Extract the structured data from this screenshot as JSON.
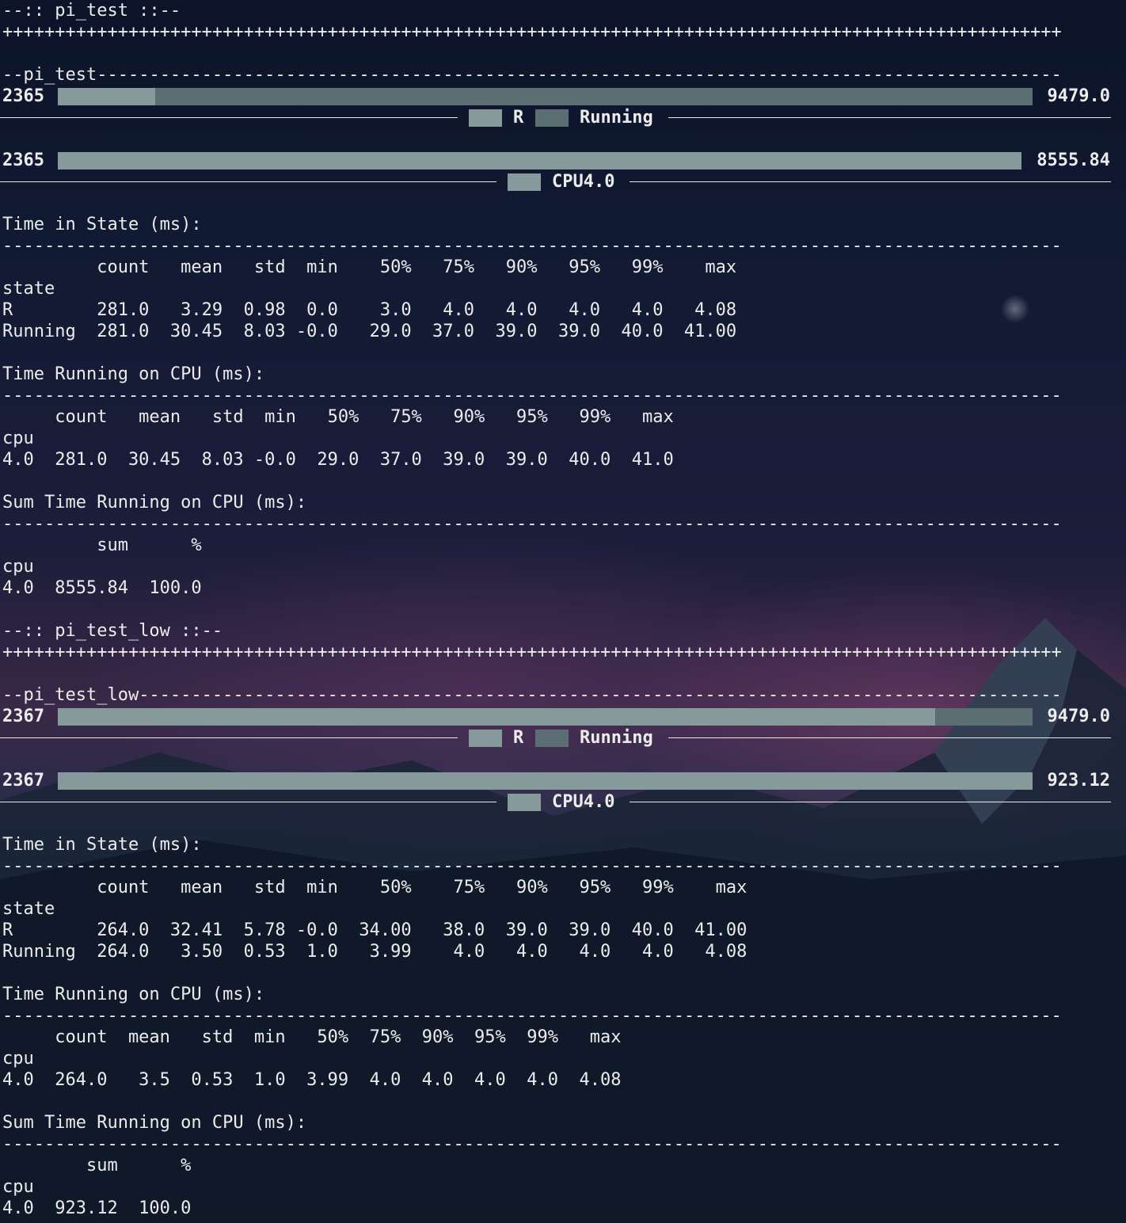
{
  "colors": {
    "light_segment": "#86999b",
    "dark_segment": "#5a6e73"
  },
  "sections": [
    {
      "header": "--:: pi_test ::--",
      "task_label": "--pi_test",
      "state_bar": {
        "pid": "2365",
        "max": "9479.0",
        "segments": [
          {
            "state": "R",
            "fraction": 0.1,
            "color": "light"
          },
          {
            "state": "Running",
            "fraction": 0.9,
            "color": "dark"
          }
        ],
        "legend": [
          {
            "label": "R",
            "color": "light"
          },
          {
            "label": "Running",
            "color": "dark"
          }
        ]
      },
      "cpu_bar": {
        "pid": "2365",
        "max": "8555.84",
        "segments": [
          {
            "state": "CPU4.0",
            "fraction": 1.0,
            "color": "light"
          }
        ],
        "legend": [
          {
            "label": "CPU4.0",
            "color": "light"
          }
        ]
      },
      "time_in_state": {
        "title": "Time in State (ms):",
        "lines": [
          "         count   mean   std  min    50%   75%   90%   95%   99%    max",
          "state",
          "R        281.0   3.29  0.98  0.0    3.0   4.0   4.0   4.0   4.0   4.08",
          "Running  281.0  30.45  8.03 -0.0   29.0  37.0  39.0  39.0  40.0  41.00"
        ]
      },
      "time_running": {
        "title": "Time Running on CPU (ms):",
        "lines": [
          "     count   mean   std  min   50%   75%   90%   95%   99%   max",
          "cpu",
          "4.0  281.0  30.45  8.03 -0.0  29.0  37.0  39.0  39.0  40.0  41.0"
        ]
      },
      "sum_time": {
        "title": "Sum Time Running on CPU (ms):",
        "lines": [
          "         sum      %",
          "cpu",
          "4.0  8555.84  100.0"
        ]
      }
    },
    {
      "header": "--:: pi_test_low ::--",
      "task_label": "--pi_test_low",
      "state_bar": {
        "pid": "2367",
        "max": "9479.0",
        "segments": [
          {
            "state": "R",
            "fraction": 0.9,
            "color": "light"
          },
          {
            "state": "Running",
            "fraction": 0.1,
            "color": "dark"
          }
        ],
        "legend": [
          {
            "label": "R",
            "color": "light"
          },
          {
            "label": "Running",
            "color": "dark"
          }
        ]
      },
      "cpu_bar": {
        "pid": "2367",
        "max": "923.12",
        "segments": [
          {
            "state": "CPU4.0",
            "fraction": 1.0,
            "color": "light"
          }
        ],
        "legend": [
          {
            "label": "CPU4.0",
            "color": "light"
          }
        ]
      },
      "time_in_state": {
        "title": "Time in State (ms):",
        "lines": [
          "         count   mean   std  min    50%    75%   90%   95%   99%    max",
          "state",
          "R        264.0  32.41  5.78 -0.0  34.00   38.0  39.0  39.0  40.0  41.00",
          "Running  264.0   3.50  0.53  1.0   3.99    4.0   4.0   4.0   4.0   4.08"
        ]
      },
      "time_running": {
        "title": "Time Running on CPU (ms):",
        "lines": [
          "     count  mean   std  min   50%  75%  90%  95%  99%   max",
          "cpu",
          "4.0  264.0   3.5  0.53  1.0  3.99  4.0  4.0  4.0  4.0  4.08"
        ]
      },
      "sum_time": {
        "title": "Sum Time Running on CPU (ms):",
        "lines": [
          "        sum      %",
          "cpu",
          "4.0  923.12  100.0"
        ]
      }
    }
  ]
}
